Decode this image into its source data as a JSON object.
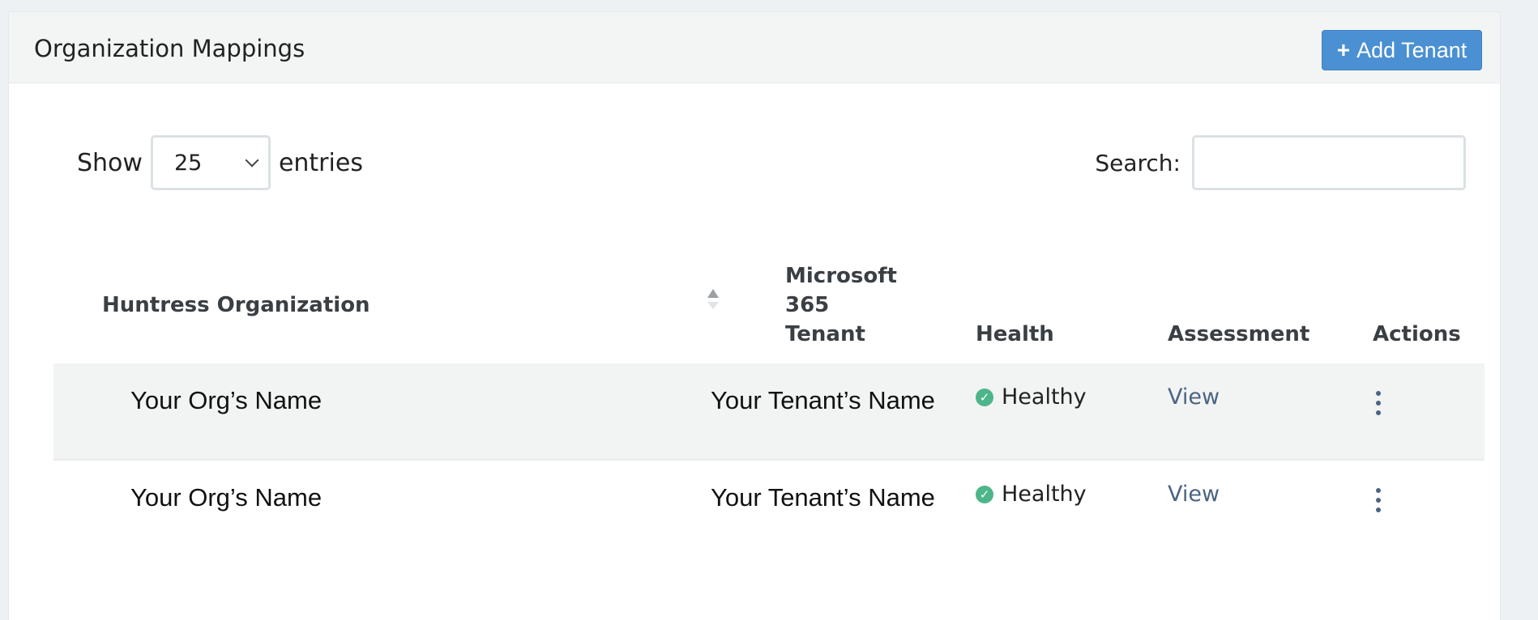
{
  "panel": {
    "title": "Organization Mappings",
    "add_button_label": "Add Tenant",
    "add_button_icon": "plus-icon"
  },
  "controls": {
    "show_label": "Show",
    "page_size": "25",
    "entries_label": "entries",
    "search_label": "Search:",
    "search_value": ""
  },
  "table": {
    "headers": {
      "organization": "Huntress Organization",
      "tenant_line1": "Microsoft",
      "tenant_line2": "365",
      "tenant_line3": "Tenant",
      "health": "Health",
      "assessment": "Assessment",
      "actions": "Actions"
    },
    "rows": [
      {
        "organization": "Your Org’s Name",
        "tenant": "Your Tenant’s Name",
        "health": "Healthy",
        "assessment": "View"
      },
      {
        "organization": "Your Org’s Name",
        "tenant": "Your Tenant’s Name",
        "health": "Healthy",
        "assessment": "View"
      }
    ]
  },
  "colors": {
    "accent": "#4a90d2",
    "healthy": "#4db58a",
    "link": "#4a6483"
  }
}
